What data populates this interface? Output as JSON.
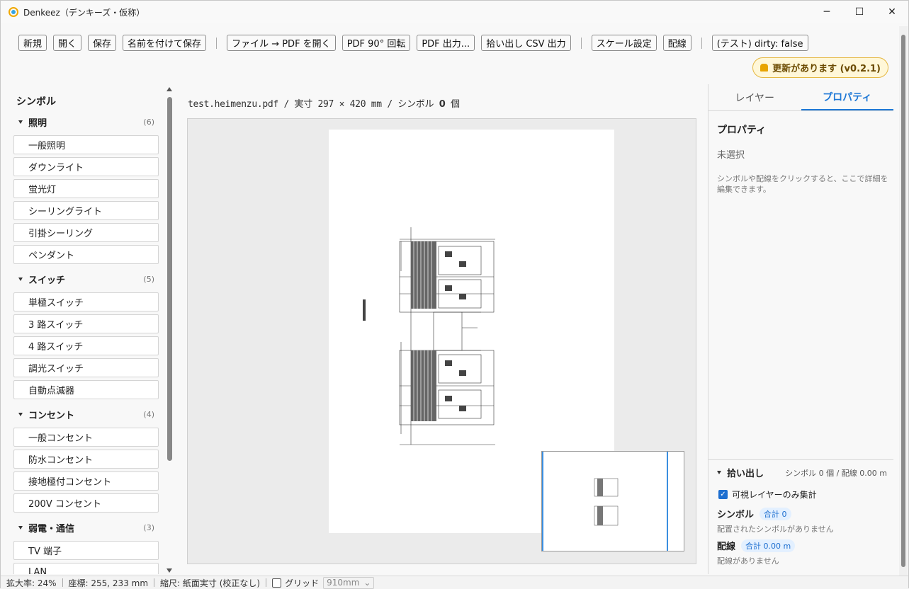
{
  "titlebar": {
    "title": "Denkeez（デンキーズ・仮称）",
    "controls": {
      "minimize": "─",
      "maximize": "☐",
      "close": "✕"
    }
  },
  "toolbar": {
    "new_label": "新規",
    "open_label": "開く",
    "save_label": "保存",
    "save_as_label": "名前を付けて保存",
    "file_to_pdf_label": "ファイル → PDF を開く",
    "pdf_rotate_label": "PDF 90° 回転",
    "pdf_export_label": "PDF 出力...",
    "csv_export_label": "拾い出し CSV 出力",
    "scale_label": "スケール設定",
    "wiring_label": "配線",
    "dirty_label": "(テスト) dirty: false",
    "update_badge": "更新があります (v0.2.1)"
  },
  "sidebar": {
    "title": "シンボル",
    "categories": [
      {
        "name": "照明",
        "count": "(6)",
        "items": [
          "一般照明",
          "ダウンライト",
          "蛍光灯",
          "シーリングライト",
          "引掛シーリング",
          "ペンダント"
        ]
      },
      {
        "name": "スイッチ",
        "count": "(5)",
        "items": [
          "単極スイッチ",
          "3 路スイッチ",
          "4 路スイッチ",
          "調光スイッチ",
          "自動点滅器"
        ]
      },
      {
        "name": "コンセント",
        "count": "(4)",
        "items": [
          "一般コンセント",
          "防水コンセント",
          "接地極付コンセント",
          "200V コンセント"
        ]
      },
      {
        "name": "弱電・通信",
        "count": "(3)",
        "items": [
          "TV 端子",
          "LAN"
        ]
      }
    ]
  },
  "main": {
    "doc_name": "test.heimenzu.pdf",
    "doc_size": " / 実寸 297 × 420 mm / シンボル ",
    "symbol_count": "0",
    "symbol_unit": " 個"
  },
  "right_panel": {
    "tabs": [
      "レイヤー",
      "プロパティ"
    ],
    "active_tab": 1,
    "prop_title": "プロパティ",
    "selection": "未選択",
    "hint": "シンボルや配線をクリックすると、ここで詳細を編集できます。",
    "pick": {
      "title": "拾い出し",
      "summary": "シンボル 0 個 / 配線 0.00 m",
      "visible_only_label": "可視レイヤーのみ集計",
      "symbols_label": "シンボル",
      "symbols_total": "合計 0",
      "symbols_empty": "配置されたシンボルがありません",
      "wiring_label": "配線",
      "wiring_total": "合計 0.00 m",
      "wiring_empty": "配線がありません"
    }
  },
  "statusbar": {
    "zoom": "拡大率: 24%",
    "coords": "座標: 255, 233 mm",
    "scale": "縮尺: 紙面実寸 (校正なし)",
    "grid_label": "グリッド",
    "grid_size": "910mm"
  },
  "colors": {
    "accent": "#1e78d6",
    "update_badge_bg": "#fff7d8",
    "update_badge_border": "#e5b843"
  }
}
